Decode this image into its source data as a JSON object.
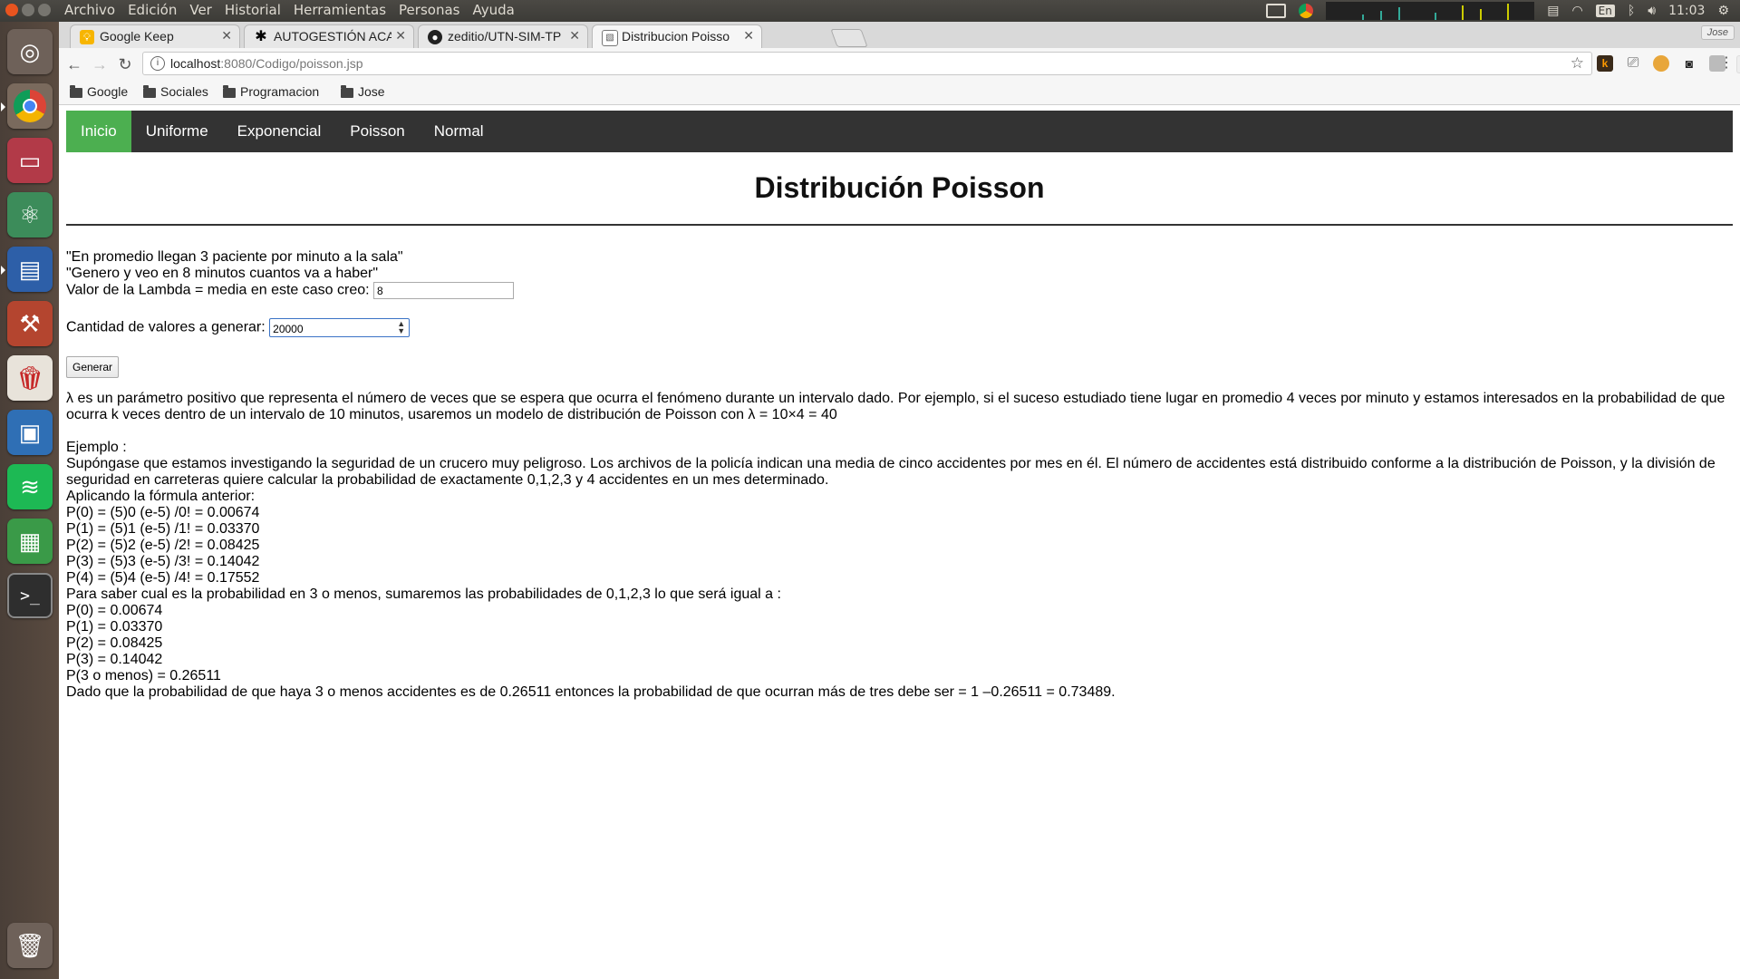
{
  "os": {
    "menu": [
      "Archivo",
      "Edición",
      "Ver",
      "Historial",
      "Herramientas",
      "Personas",
      "Ayuda"
    ],
    "keyboard": "En",
    "clock": "11:03"
  },
  "launcher": {
    "apps": [
      "ubuntu-dash",
      "chrome",
      "files",
      "atom",
      "writer",
      "system-settings",
      "popcorn-time",
      "virtualbox",
      "spotify",
      "calc",
      "terminal",
      "trash"
    ]
  },
  "browser": {
    "tabs": [
      {
        "title": "Google Keep",
        "favicon": "keep-icon"
      },
      {
        "title": "AUTOGESTIÓN ACA",
        "favicon": "utn-icon"
      },
      {
        "title": "zeditio/UTN-SIM-TP",
        "favicon": "github-icon"
      },
      {
        "title": "Distribucion Poisso",
        "favicon": "page-icon"
      }
    ],
    "profile": "Jose",
    "url_host": "localhost",
    "url_rest": ":8080/Codigo/poisson.jsp",
    "bookmarks": [
      {
        "label": "Google",
        "type": "folder"
      },
      {
        "label": "Sociales",
        "type": "folder"
      },
      {
        "label": "Programacion",
        "type": "folder"
      },
      {
        "label": "Jose",
        "type": "folder"
      }
    ]
  },
  "page": {
    "nav": [
      "Inicio",
      "Uniforme",
      "Exponencial",
      "Poisson",
      "Normal"
    ],
    "nav_active": "Inicio",
    "title": "Distribución Poisson",
    "quote1": "\"En promedio llegan 3 paciente por minuto a la sala\"",
    "quote2": "\"Genero y veo en 8 minutos cuantos va a haber\"",
    "lambda_label": "Valor de la Lambda = media en este caso creo:",
    "lambda_value": "8",
    "cantidad_label": "Cantidad de valores a generar:",
    "cantidad_value": "20000",
    "generar_button": "Generar",
    "description": "λ es un parámetro positivo que representa el número de veces que se espera que ocurra el fenómeno durante un intervalo dado. Por ejemplo, si el suceso estudiado tiene lugar en promedio 4 veces por minuto y estamos interesados en la probabilidad de que ocurra k veces dentro de un intervalo de 10 minutos, usaremos un modelo de distribución de Poisson con λ = 10×4 = 40",
    "example_heading": "Ejemplo :",
    "example_text": "Supóngase que estamos investigando la seguridad de un crucero muy peligroso. Los archivos de la policía indican una media de cinco accidentes por mes en él. El número de accidentes está distribuido conforme a la distribución de Poisson, y la división de seguridad en carreteras quiere calcular la probabilidad de exactamente 0,1,2,3 y 4 accidentes en un mes determinado.",
    "applying": "Aplicando la fórmula anterior:",
    "formulas": [
      "P(0) = (5)0 (e-5) /0! = 0.00674",
      "P(1) = (5)1 (e-5) /1! = 0.03370",
      "P(2) = (5)2 (e-5) /2! = 0.08425",
      "P(3) = (5)3 (e-5) /3! = 0.14042",
      "P(4) = (5)4 (e-5) /4! = 0.17552"
    ],
    "sum_intro": "Para saber cual es la probabilidad en 3 o menos, sumaremos las probabilidades de 0,1,2,3 lo que será igual a :",
    "sums": [
      "P(0) = 0.00674",
      "P(1) = 0.03370",
      "P(2) = 0.08425",
      "P(3) = 0.14042",
      "P(3 o menos) = 0.26511"
    ],
    "conclusion": "Dado que la probabilidad de que haya 3 o menos accidentes es de 0.26511 entonces la probabilidad de que ocurran más de tres debe ser = 1 –0.26511 = 0.73489."
  },
  "colors": {
    "nav_bg": "#333333",
    "nav_active": "#4caf50",
    "close_btn": "#e9541f"
  }
}
